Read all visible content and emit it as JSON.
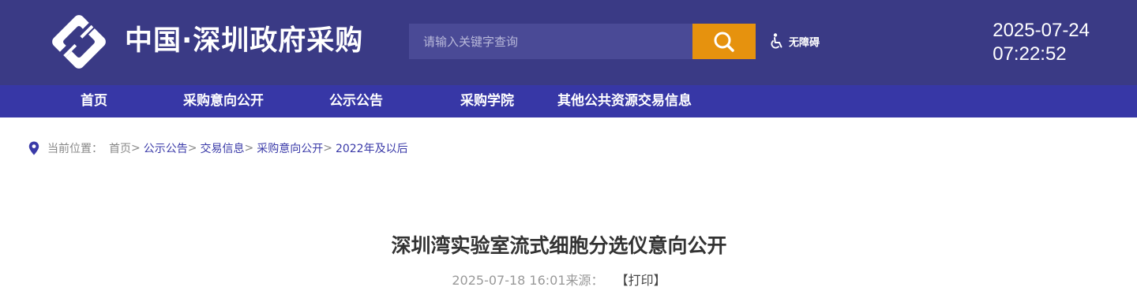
{
  "header": {
    "site_title": "中国·深圳政府采购",
    "search": {
      "placeholder": "请输入关键字查询",
      "button_icon": "search-icon"
    },
    "accessibility_label": "无障碍",
    "clock": {
      "date": "2025-07-24",
      "time": "07:22:52"
    }
  },
  "nav": {
    "items": [
      {
        "label": "首页"
      },
      {
        "label": "采购意向公开"
      },
      {
        "label": "公示公告"
      },
      {
        "label": "采购学院"
      },
      {
        "label": "其他公共资源交易信息"
      }
    ]
  },
  "breadcrumb": {
    "prefix": "当前位置：",
    "items": [
      {
        "label": "首页"
      },
      {
        "label": "公示公告"
      },
      {
        "label": "交易信息"
      },
      {
        "label": "采购意向公开"
      },
      {
        "label": "2022年及以后"
      }
    ],
    "separator": ">"
  },
  "article": {
    "title": "深圳湾实验室流式细胞分选仪意向公开",
    "date": "2025-07-18 16:01",
    "source_label": "来源：",
    "print_label": "【打印】"
  },
  "colors": {
    "header_bg": "#3a3a85",
    "nav_bg": "#3737a6",
    "search_button": "#e6920e",
    "link": "#3a3aa8"
  }
}
